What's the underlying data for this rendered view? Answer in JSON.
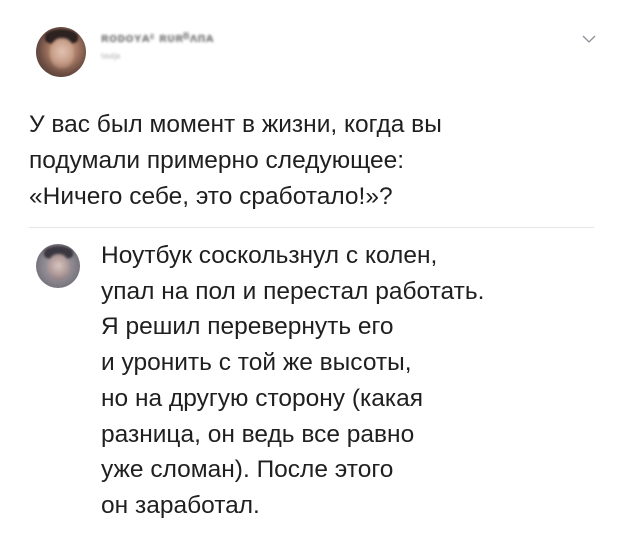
{
  "post": {
    "author": {
      "name": "ʀᴏᴅᴏʏᴀᵋ  ʀᴜʀᴮᴧᴨᴀ",
      "handle": "ᵗᵊᵘᵗʲᵃ",
      "avatar_icon": "user-avatar"
    },
    "menu_icon": "chevron-down-icon",
    "text_lines": [
      "У вас был момент в жизни, когда вы",
      "подумали примерно следующее:",
      "«Ничего себе, это сработало!»?"
    ]
  },
  "reply": {
    "avatar_icon": "user-avatar",
    "text_lines": [
      "Ноутбук соскользнул с колен,",
      "упал на пол и перестал работать.",
      "Я решил перевернуть его",
      "и уронить с той же высоты,",
      "но на другую сторону (какая",
      "разница, он ведь все равно",
      "уже сломан). После этого",
      "он заработал."
    ]
  },
  "colors": {
    "text": "#1f1f1f",
    "muted": "#a8a8a8",
    "divider": "#e3e6e8",
    "background": "#ffffff"
  }
}
